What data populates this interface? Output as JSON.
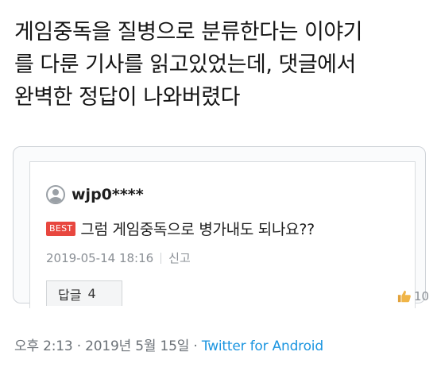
{
  "tweet": {
    "lines": [
      "게임중독을 질병으로 분류한다는 이야기",
      "를 다룬 기사를 읽고있었는데, 댓글에서",
      "완벽한 정답이 나와버렸다"
    ],
    "time": "오후 2:13",
    "separator": "·",
    "date": "2019년 5월 15일",
    "separator2": "·",
    "via": "Twitter for Android"
  },
  "comment_card": {
    "username": "wjp0****",
    "badge": "BEST",
    "text": "그럼 게임중독으로 병가내도 되나요??",
    "timestamp": "2019-05-14 18:16",
    "report_label": "신고",
    "reply_label": "답글",
    "reply_count": "4",
    "like_count": "10"
  },
  "colors": {
    "badge": "#e8473f",
    "via_link": "#1b95e0"
  }
}
